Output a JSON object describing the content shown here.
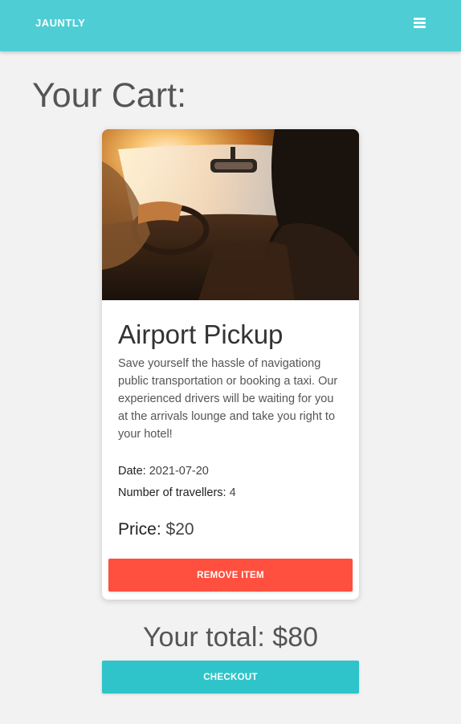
{
  "navbar": {
    "brand": "JAUNTLY",
    "menu_icon": "hamburger-menu-icon",
    "background_color": "#4ecdd4"
  },
  "page": {
    "title": "Your Cart:"
  },
  "cart": {
    "items": [
      {
        "image_icon": "car-interior-photo",
        "title": "Airport Pickup",
        "description": "Save yourself the hassle of navigationg public transportation or booking a taxi. Our experienced drivers will be waiting for you at the arrivals lounge and take you right to your hotel!",
        "date_label": "Date:",
        "date_value": "2021-07-20",
        "travellers_label": "Number of travellers:",
        "travellers_value": "4",
        "price_label": "Price:",
        "price_value": "$20",
        "remove_label": "REMOVE ITEM",
        "remove_color": "#ff4f3f"
      }
    ]
  },
  "summary": {
    "total_text": "Your total: $80",
    "checkout_label": "CHECKOUT",
    "checkout_color": "#2ec4c9"
  }
}
